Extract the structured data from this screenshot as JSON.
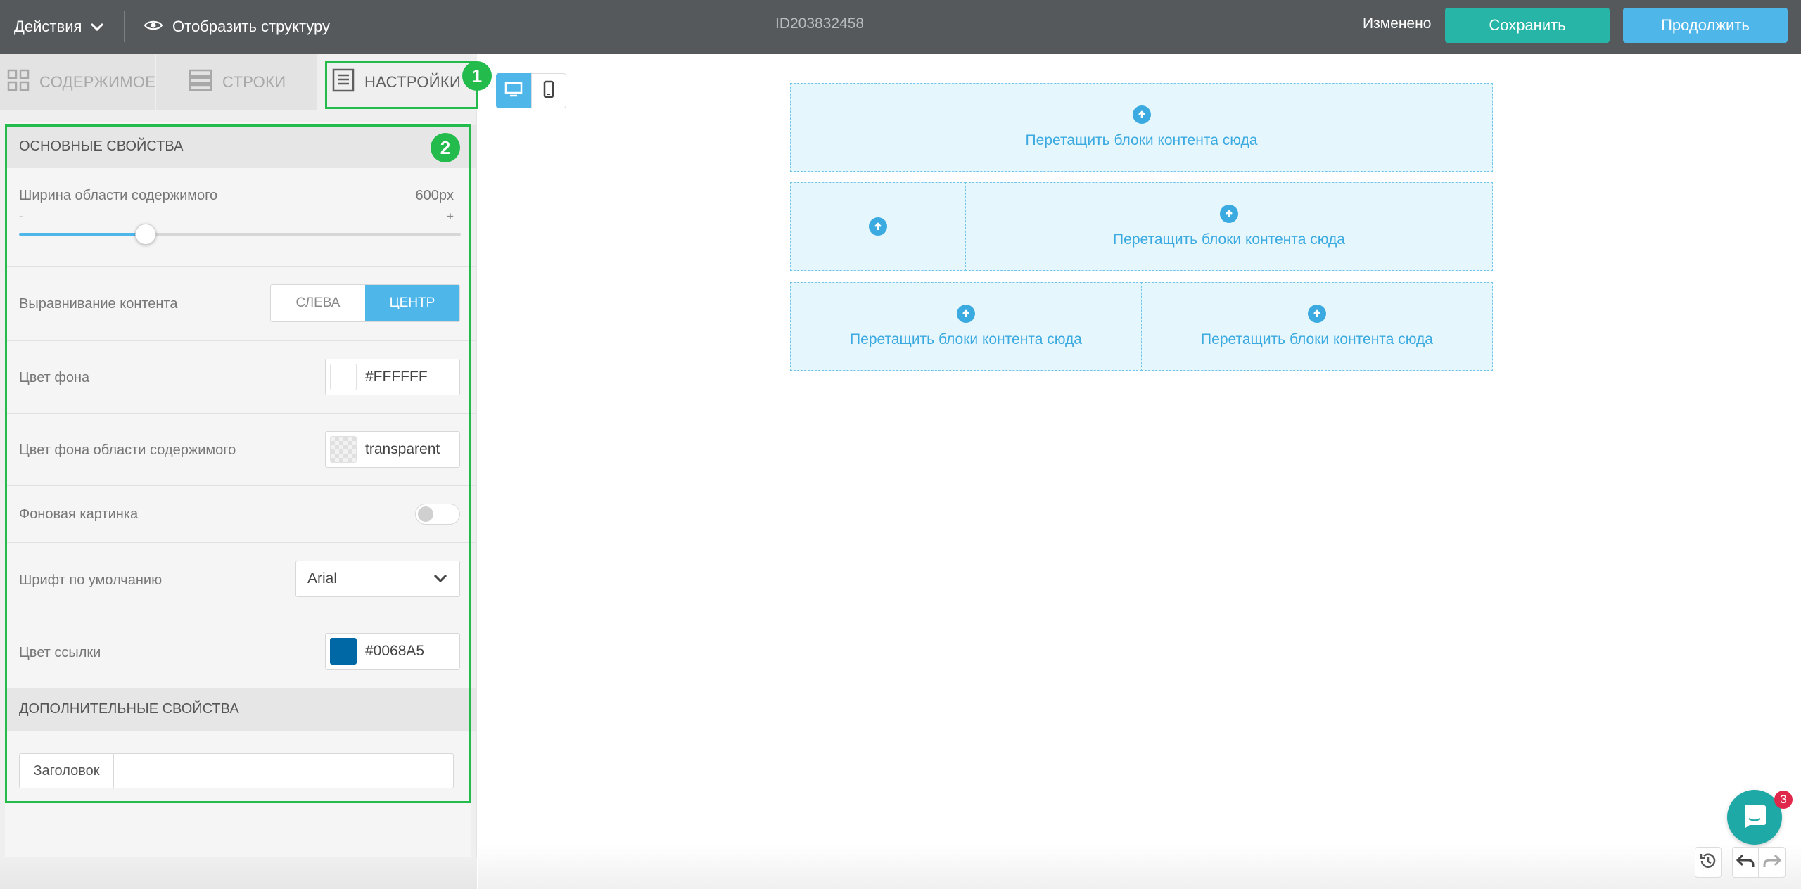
{
  "topbar": {
    "actions_label": "Действия",
    "structure_label": "Отобразить структуру",
    "doc_id": "ID203832458",
    "status": "Изменено",
    "save_label": "Сохранить",
    "continue_label": "Продолжить",
    "colors": {
      "bar": "#55595c",
      "save": "#26b5a6",
      "continue": "#4fb6ea"
    }
  },
  "tabs": [
    {
      "label": "Содержимое",
      "icon": "grid-icon",
      "active": false
    },
    {
      "label": "Строки",
      "icon": "rows-icon",
      "active": false
    },
    {
      "label": "Настройки",
      "icon": "settings-doc-icon",
      "active": true
    }
  ],
  "callouts": {
    "one": "1",
    "two": "2"
  },
  "device_toggle": {
    "selected": "desktop",
    "options": [
      "desktop-icon",
      "mobile-icon"
    ]
  },
  "settings": {
    "basic_header": "Основные свойства",
    "content_width": {
      "label": "Ширина области содержимого",
      "value": "600px",
      "min_label": "-",
      "max_label": "+",
      "level": 0.287
    },
    "alignment": {
      "label": "Выравнивание контента",
      "options": [
        "Слева",
        "Центр"
      ],
      "selected": "Центр"
    },
    "background_color": {
      "label": "Цвет фона",
      "value": "#FFFFFF"
    },
    "content_bg_color": {
      "label": "Цвет фона области содержимого",
      "value": "transparent"
    },
    "background_image": {
      "label": "Фоновая картинка",
      "enabled": false
    },
    "default_font": {
      "label": "Шрифт по умолчанию",
      "value": "Arial"
    },
    "link_color": {
      "label": "Цвет ссылки",
      "value": "#0068A5"
    },
    "advanced_header": "Дополнительные свойства",
    "title_field": {
      "label": "Заголовок",
      "value": ""
    }
  },
  "canvas": {
    "drop_text": "Перетащить блоки контента сюда",
    "accent": "#3aaae0",
    "rows": [
      {
        "columns": [
          {
            "text": "Перетащить блоки контента сюда"
          }
        ]
      },
      {
        "columns": [
          {
            "text": ""
          },
          {
            "text": "Перетащить блоки контента сюда"
          }
        ]
      },
      {
        "columns": [
          {
            "text": "Перетащить блоки контента сюда"
          },
          {
            "text": "Перетащить блоки контента сюда"
          }
        ]
      }
    ]
  },
  "chat": {
    "unread": "3",
    "icon": "chat-icon"
  },
  "history_controls": [
    "history-icon",
    "undo-icon",
    "redo-icon"
  ]
}
